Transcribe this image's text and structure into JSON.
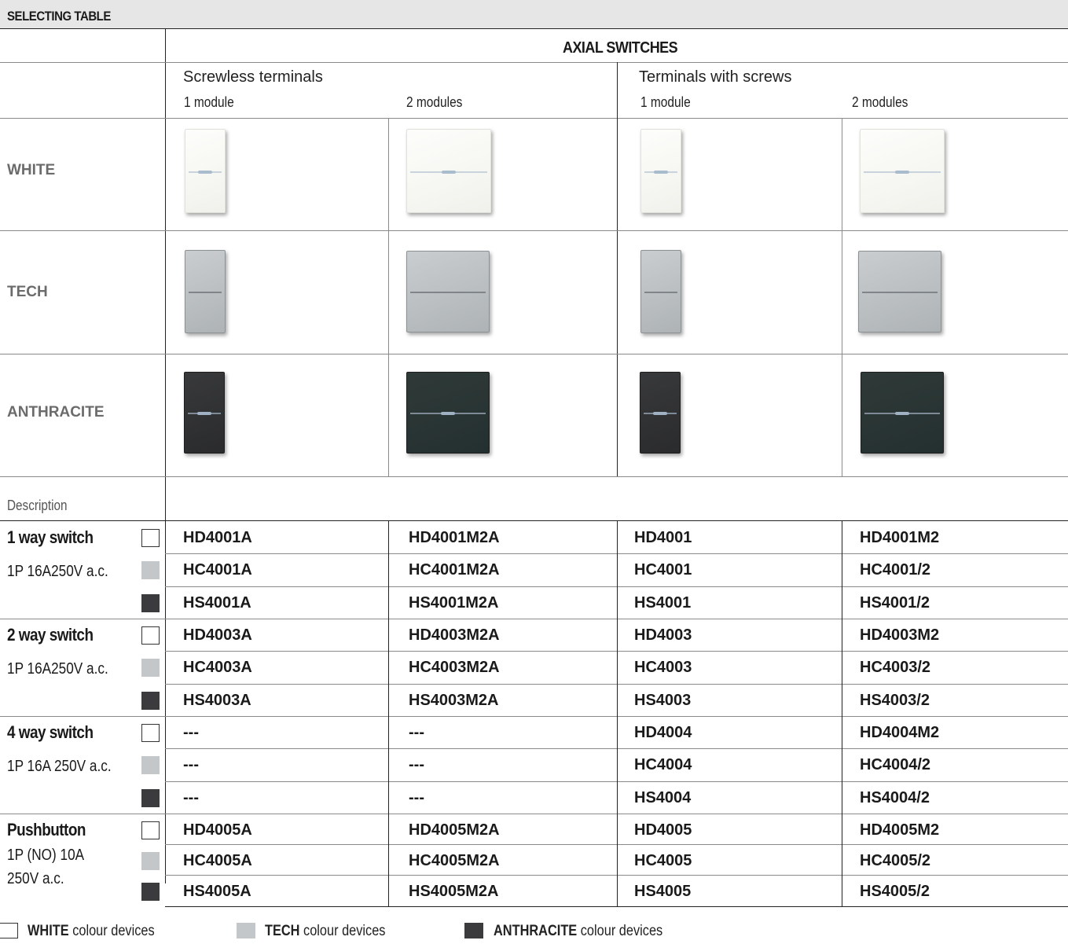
{
  "title": "SELECTING TABLE",
  "group_title": "AXIAL SWITCHES",
  "subgroups": [
    "Screwless terminals",
    "Terminals with screws"
  ],
  "module_labels": [
    "1 module",
    "2 modules",
    "1 module",
    "2 modules"
  ],
  "finishes": [
    "WHITE",
    "TECH",
    "ANTHRACITE"
  ],
  "description_label": "Description",
  "colors": {
    "white": "#ffffff",
    "tech": "#c3c7ca",
    "anthracite": "#3b3b3d"
  },
  "items": [
    {
      "title": "1 way switch",
      "spec": "1P 16A250V a.c.",
      "rows": [
        [
          "HD4001A",
          "HD4001M2A",
          "HD4001",
          "HD4001M2"
        ],
        [
          "HC4001A",
          "HC4001M2A",
          "HC4001",
          "HC4001/2"
        ],
        [
          "HS4001A",
          "HS4001M2A",
          "HS4001",
          "HS4001/2"
        ]
      ]
    },
    {
      "title": "2 way switch",
      "spec": "1P 16A250V a.c.",
      "rows": [
        [
          "HD4003A",
          "HD4003M2A",
          "HD4003",
          "HD4003M2"
        ],
        [
          "HC4003A",
          "HC4003M2A",
          "HC4003",
          "HC4003/2"
        ],
        [
          "HS4003A",
          "HS4003M2A",
          "HS4003",
          "HS4003/2"
        ]
      ]
    },
    {
      "title": "4 way switch",
      "spec": "1P 16A 250V a.c.",
      "rows": [
        [
          "---",
          "---",
          "HD4004",
          "HD4004M2"
        ],
        [
          "---",
          "---",
          "HC4004",
          "HC4004/2"
        ],
        [
          "---",
          "---",
          "HS4004",
          "HS4004/2"
        ]
      ]
    },
    {
      "title": "Pushbutton",
      "spec_lines": [
        "1P (NO) 10A",
        "250V a.c."
      ],
      "rows": [
        [
          "HD4005A",
          "HD4005M2A",
          "HD4005",
          "HD4005M2"
        ],
        [
          "HC4005A",
          "HC4005M2A",
          "HC4005",
          "HC4005/2"
        ],
        [
          "HS4005A",
          "HS4005M2A",
          "HS4005",
          "HS4005/2"
        ]
      ]
    }
  ],
  "legend": [
    {
      "bold": "WHITE",
      "text": " colour devices"
    },
    {
      "bold": "TECH",
      "text": " colour devices"
    },
    {
      "bold": "ANTHRACITE",
      "text": " colour devices"
    }
  ]
}
